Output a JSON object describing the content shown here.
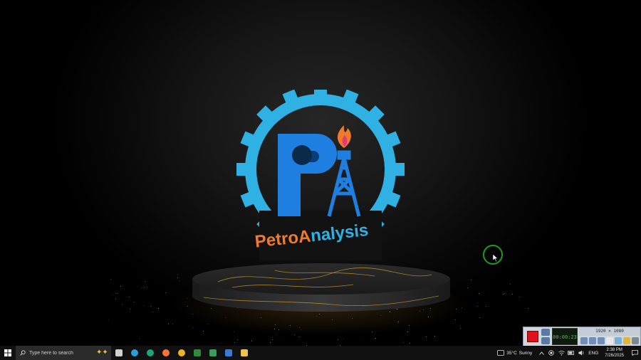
{
  "logo": {
    "brand_text": "PetroAnalysis",
    "colors": {
      "gear": "#2fb1e3",
      "letters": "#1e7fe0",
      "petro": "#f07a2a",
      "analysis": "#2fb1e3",
      "flame": "#f07a2a"
    }
  },
  "recorder": {
    "display_value": "00:00:23",
    "resolution": "1920 × 1080"
  },
  "taskbar": {
    "search_placeholder": "Type here to search",
    "apps": [
      {
        "name": "task-view",
        "color": "#cfcfcf"
      },
      {
        "name": "telegram",
        "color": "#2aa0da"
      },
      {
        "name": "edge",
        "color": "#1fa37a"
      },
      {
        "name": "firefox",
        "color": "#ff7139"
      },
      {
        "name": "chrome",
        "color": "#e8b622"
      },
      {
        "name": "excel-file",
        "color": "#2e8b3e"
      },
      {
        "name": "image-viewer",
        "color": "#3c9a5f"
      },
      {
        "name": "vpn-app",
        "color": "#3a7bd5"
      },
      {
        "name": "file-explorer",
        "color": "#f2c14e"
      }
    ],
    "weather": {
      "temp": "35°C",
      "condition": "Sunny"
    },
    "language": "ENG",
    "time": "2:38 PM",
    "date": "7/26/2025"
  }
}
